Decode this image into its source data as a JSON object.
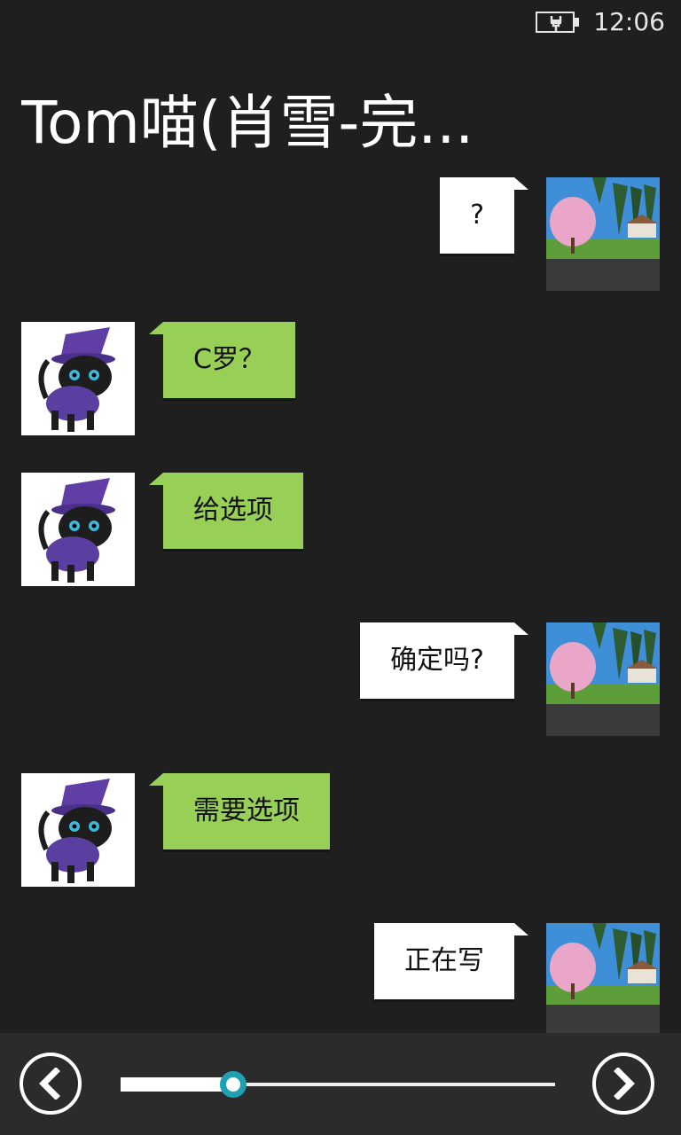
{
  "status": {
    "time": "12:06",
    "battery_icon": "battery-charging-icon"
  },
  "header": {
    "title": "Tom喵(肖雪-完..."
  },
  "colors": {
    "background": "#1f1f1f",
    "incoming_bubble": "#98cf56",
    "outgoing_bubble": "#ffffff",
    "slider_accent": "#1f9fb3"
  },
  "messages": [
    {
      "sender": "me",
      "text": "?"
    },
    {
      "sender": "contact",
      "text": "C罗？"
    },
    {
      "sender": "contact",
      "text": "给选项"
    },
    {
      "sender": "me",
      "text": "确定吗?"
    },
    {
      "sender": "contact",
      "text": "需要选项"
    },
    {
      "sender": "me",
      "text": "正在写"
    }
  ],
  "controls": {
    "prev_icon": "chevron-left-icon",
    "next_icon": "chevron-right-icon",
    "slider_progress": 0.26
  }
}
